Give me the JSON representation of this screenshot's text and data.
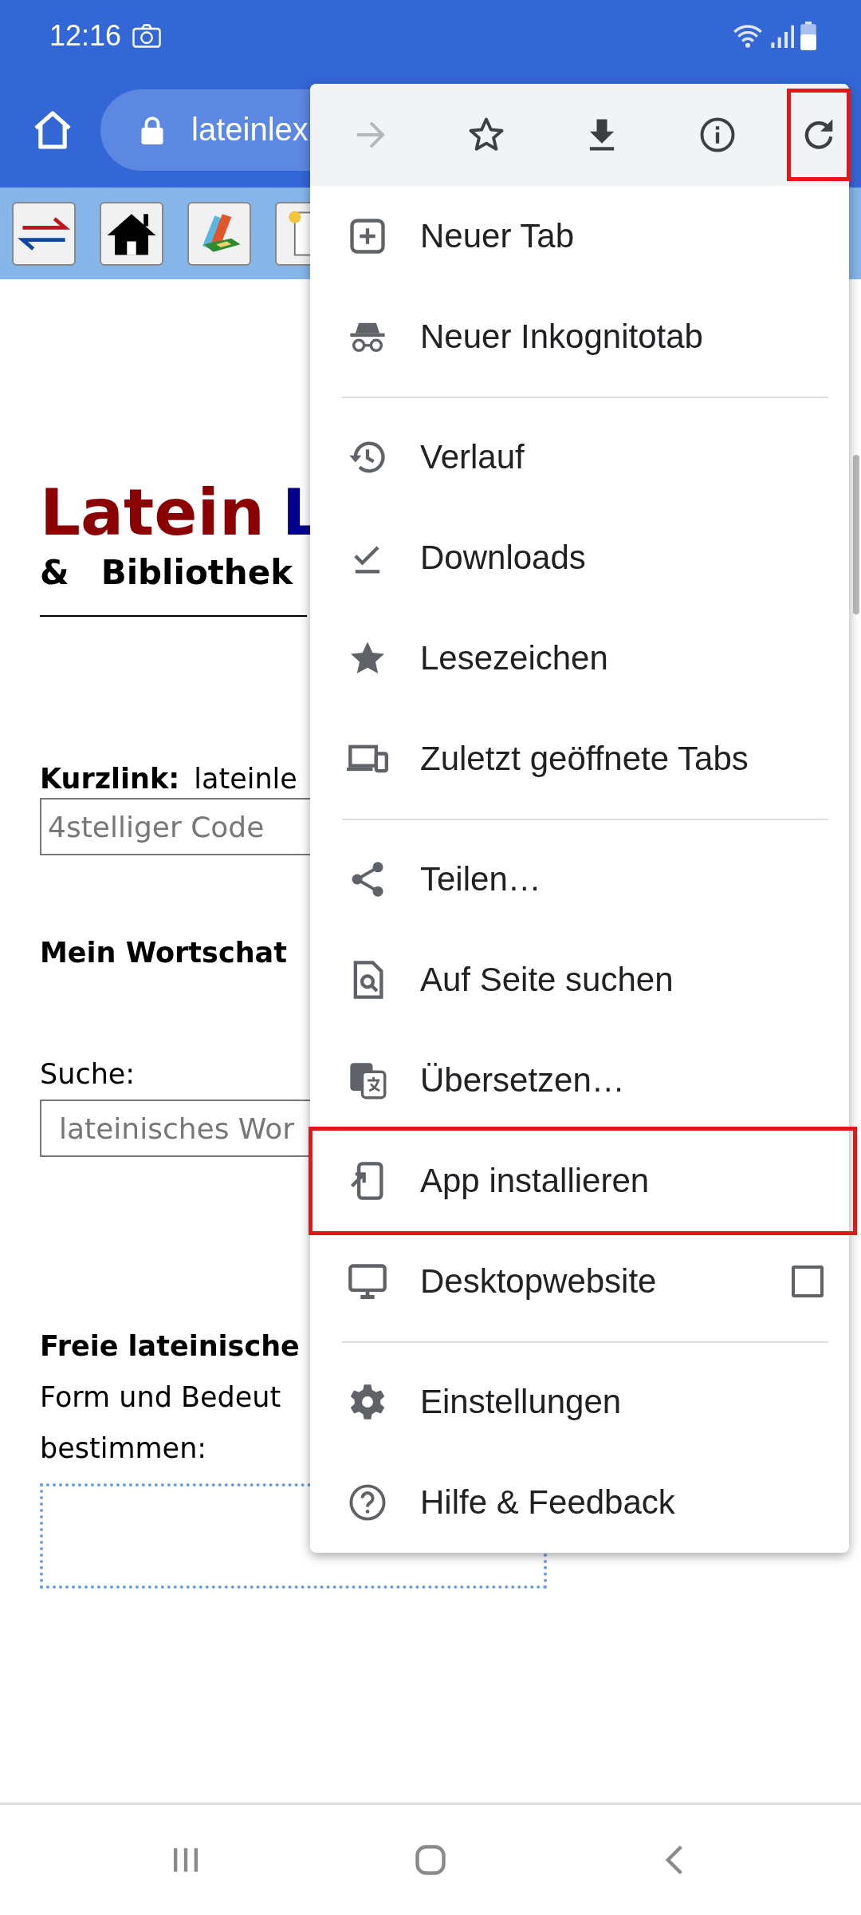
{
  "status_bar": {
    "time": "12:16"
  },
  "toolbar": {
    "url": "lateinlex"
  },
  "page": {
    "title": "Latein",
    "title_cut": "L",
    "subtitle_mark": "&",
    "subtitle": "Bibliothek",
    "kurzlink": {
      "label": "Kurzlink:",
      "value": "lateinle",
      "placeholder": "4stelliger Code"
    },
    "wortschatz_heading": "Mein Wortschat",
    "search": {
      "label": "Suche:",
      "placeholder": "lateinisches Wor"
    },
    "free_form": {
      "heading": "Freie lateinische",
      "lines": [
        "Form und Bedeut",
        "bestimmen:"
      ]
    }
  },
  "menu": {
    "actions": [
      {
        "kind": "forward",
        "disabled": true,
        "highlighted": false
      },
      {
        "kind": "bookmark",
        "disabled": false,
        "highlighted": false
      },
      {
        "kind": "download",
        "disabled": false,
        "highlighted": false
      },
      {
        "kind": "info",
        "disabled": false,
        "highlighted": false
      },
      {
        "kind": "reload",
        "disabled": false,
        "highlighted": true
      }
    ],
    "items": [
      {
        "kind": "new-tab",
        "label": "Neuer Tab",
        "highlighted": false
      },
      {
        "kind": "incognito",
        "label": "Neuer Inkognitotab",
        "highlighted": false
      },
      {
        "kind": "divider"
      },
      {
        "kind": "history",
        "label": "Verlauf",
        "highlighted": false
      },
      {
        "kind": "downloads",
        "label": "Downloads",
        "highlighted": false
      },
      {
        "kind": "bookmarks",
        "label": "Lesezeichen",
        "highlighted": false
      },
      {
        "kind": "recent-tabs",
        "label": "Zuletzt geöffnete Tabs",
        "highlighted": false
      },
      {
        "kind": "divider"
      },
      {
        "kind": "share",
        "label": "Teilen…",
        "highlighted": false
      },
      {
        "kind": "find",
        "label": "Auf Seite suchen",
        "highlighted": false
      },
      {
        "kind": "translate",
        "label": "Übersetzen…",
        "highlighted": false
      },
      {
        "kind": "install",
        "label": "App installieren",
        "highlighted": true
      },
      {
        "kind": "desktop",
        "label": "Desktopwebsite",
        "highlighted": false,
        "checked": false
      },
      {
        "kind": "divider"
      },
      {
        "kind": "settings",
        "label": "Einstellungen",
        "highlighted": false
      },
      {
        "kind": "help",
        "label": "Hilfe & Feedback",
        "highlighted": false
      }
    ]
  }
}
